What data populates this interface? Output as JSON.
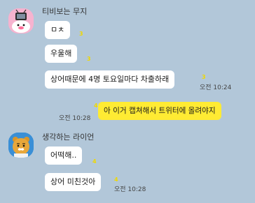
{
  "chat": {
    "group1": {
      "sender": "티비보는 무지",
      "messages": [
        {
          "text": "ㅁㅊ",
          "unread": "3"
        },
        {
          "text": "우울해",
          "unread": "3"
        },
        {
          "text": "상어때문에 4명 토요일마다 차출하래",
          "unread": "3",
          "time": "오전 10:24"
        }
      ]
    },
    "mine": {
      "text": "아 이거 캡쳐해서 트위터에 올려야지",
      "unread": "4",
      "time": "오전 10:28"
    },
    "group2": {
      "sender": "생각하는 라이언",
      "messages": [
        {
          "text": "어떡해..",
          "unread": "4"
        },
        {
          "text": "상어 미친것아",
          "unread": "4",
          "time": "오전 10:28"
        }
      ]
    }
  },
  "colors": {
    "background": "#b2c7d9",
    "my_bubble": "#ffeb33",
    "their_bubble": "#ffffff",
    "unread": "#f0d800"
  },
  "icons": {
    "avatar1": "muzi-avatar-icon",
    "avatar2": "ryan-avatar-icon"
  }
}
